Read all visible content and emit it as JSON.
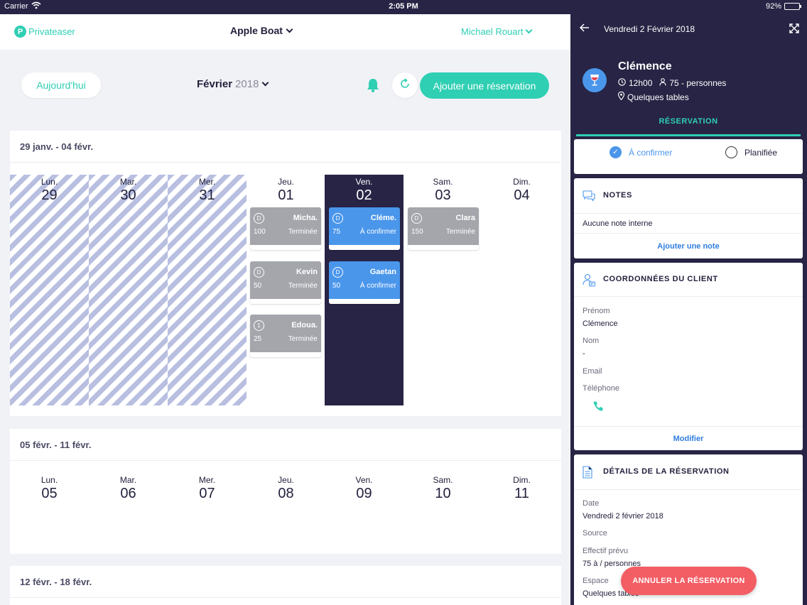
{
  "status_bar": {
    "carrier": "Carrier",
    "time": "2:05 PM",
    "battery": "92%",
    "battery_level": 0.92
  },
  "header": {
    "logo": "Privateaser",
    "boat": "Apple Boat",
    "user": "Michael Rouart"
  },
  "toolbar": {
    "today": "Aujourd'hui",
    "month": "Février",
    "year": "2018",
    "add": "Ajouter une réservation"
  },
  "weeks": [
    {
      "title": "29 janv. - 04 févr.",
      "days": [
        {
          "name": "Lun.",
          "num": "29"
        },
        {
          "name": "Mar.",
          "num": "30"
        },
        {
          "name": "Mer.",
          "num": "31"
        },
        {
          "name": "Jeu.",
          "num": "01"
        },
        {
          "name": "Ven.",
          "num": "02"
        },
        {
          "name": "Sam.",
          "num": "03"
        },
        {
          "name": "Dim.",
          "num": "04"
        }
      ]
    },
    {
      "title": "05 févr. - 11 févr.",
      "days": [
        {
          "name": "Lun.",
          "num": "05"
        },
        {
          "name": "Mar.",
          "num": "06"
        },
        {
          "name": "Mer.",
          "num": "07"
        },
        {
          "name": "Jeu.",
          "num": "08"
        },
        {
          "name": "Ven.",
          "num": "09"
        },
        {
          "name": "Sam.",
          "num": "10"
        },
        {
          "name": "Dim.",
          "num": "11"
        }
      ]
    },
    {
      "title": "12 févr. - 18 févr."
    }
  ],
  "bookings": [
    {
      "badge": "D",
      "name": "Micha.",
      "count": "100",
      "status": "Terminée",
      "color": "#a4a6ac"
    },
    {
      "badge": "D",
      "name": "Kevin",
      "count": "50",
      "status": "Terminée",
      "color": "#a4a6ac"
    },
    {
      "badge": "1",
      "name": "Edoua.",
      "count": "25",
      "status": "Terminée",
      "color": "#a4a6ac"
    },
    {
      "badge": "D",
      "name": "Cléme.",
      "count": "75",
      "status": "À confirmer",
      "color": "#4a96eb"
    },
    {
      "badge": "D",
      "name": "Gaetan",
      "count": "50",
      "status": "À confirmer",
      "color": "#4a96eb"
    },
    {
      "badge": "D",
      "name": "Clara",
      "count": "150",
      "status": "Terminée",
      "color": "#a4a6ac"
    }
  ],
  "panel": {
    "date": "Vendredi 2 Février 2018",
    "guest": {
      "name": "Clémence",
      "time": "12h00",
      "people": "75 - personnes",
      "place": "Quelques tables"
    },
    "tab": "RÉSERVATION",
    "status": {
      "option1": "À confirmer",
      "option2": "Planifiée"
    },
    "notes": {
      "title": "NOTES",
      "text": "Aucune note interne",
      "action": "Ajouter une note"
    },
    "client": {
      "title": "COORDONNÉES DU CLIENT",
      "firstname_label": "Prénom",
      "firstname": "Clémence",
      "lastname_label": "Nom",
      "lastname": "-",
      "email_label": "Email",
      "phone_label": "Téléphone",
      "action": "Modifier"
    },
    "details": {
      "title": "DÉTAILS DE LA RÉSERVATION",
      "date_label": "Date",
      "date": "Vendredi 2 février 2018",
      "source_label": "Source",
      "size_label": "Effectif prévu",
      "size": "75 à / personnes",
      "space_label": "Espace",
      "space": "Quelques tables"
    },
    "cancel": "ANNULER LA RÉSERVATION"
  },
  "colors": {
    "accent": "#2fcfb3",
    "navy": "#272445",
    "blue": "#4a96eb",
    "grey": "#a4a6ac",
    "danger": "#f35d64"
  }
}
